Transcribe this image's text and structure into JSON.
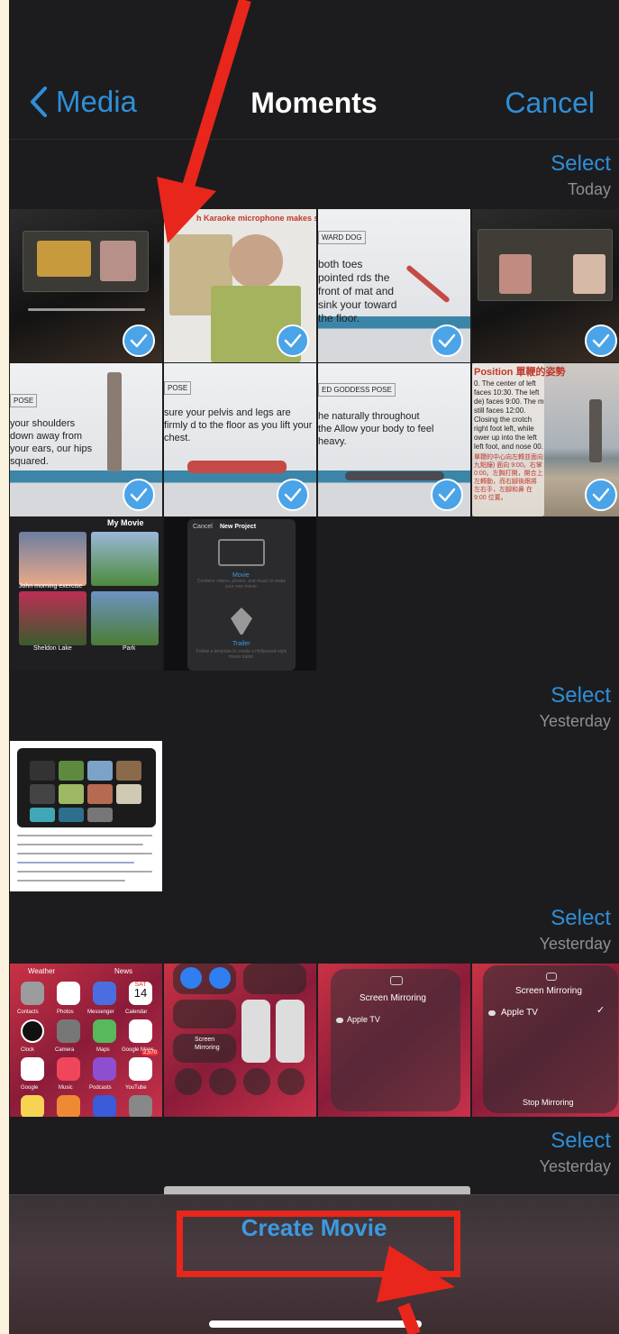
{
  "nav": {
    "back_label": "Media",
    "title": "Moments",
    "cancel_label": "Cancel"
  },
  "sections": [
    {
      "select_label": "Select",
      "date": "Today"
    },
    {
      "select_label": "Select",
      "date": "Yesterday"
    },
    {
      "select_label": "Select",
      "date": "Yesterday"
    },
    {
      "select_label": "Select",
      "date": "Yesterday"
    }
  ],
  "thumbs": {
    "t2_caption": "h Karaoke microphone makes singing easy",
    "t3_tag": "WARD DOG",
    "t3_text": "both toes pointed rds the front of mat and sink your toward the floor.",
    "t5_tag": "POSE",
    "t5_text": "your shoulders down away from your ears, our hips squared.",
    "t6_tag": "POSE",
    "t6_text": "sure your pelvis and legs are firmly d to the floor as you lift your chest.",
    "t7_tag": "ED GODDESS POSE",
    "t7_text": "he naturally throughout the Allow your body to feel heavy.",
    "t8_title": "Position 單鞭的姿勢",
    "t8_text": "0. The center of left faces 10:30. The left de) faces 9:00. The m still faces 12:00. Closing the crotch right foot left, while ower up into the left left foot, and nose 00.",
    "t8_red": "單鞭的中心向左轉並面向 九點鐘) 面向 9:00。右掌 0:00。左胸打開，開合上 左轉動，而右腳後跟將 左右手，左腳和鼻 在 9:00 位置。",
    "t9_header": "My Movie",
    "t9_cap1": "John morning exercise",
    "t9_cap2": "Sheldon Lake",
    "t9_cap3": "Park",
    "t10_cancel": "Cancel",
    "t10_title": "New Project",
    "t10_movie": "Movie",
    "t10_movie_desc": "Combine videos, photos, and music to make your own movie.",
    "t10_trailer": "Trailer",
    "t10_trailer_desc": "Follow a template to create a Hollywood-style movie trailer.",
    "t12_weather": "Weather",
    "t12_news": "News",
    "t12_apps": [
      "Contacts",
      "Photos",
      "Messenger",
      "Calendar",
      "Clock",
      "Camera",
      "Maps",
      "Google Maps",
      "Google",
      "Music",
      "Podcasts",
      "YouTube"
    ],
    "t12_day": "SAT",
    "t12_date": "14",
    "t12_badge": "2,570",
    "t13_mirroring": "Screen Mirroring",
    "t14_title": "Screen Mirroring",
    "t14_device": "Apple TV",
    "t15_title": "Screen Mirroring",
    "t15_device": "Apple TV",
    "t15_stop": "Stop Mirroring"
  },
  "bottom": {
    "create_label": "Create Movie"
  },
  "colors": {
    "accent": "#2f8fd8",
    "annotation": "#e8261b",
    "checkmark": "#4ba3e8"
  }
}
